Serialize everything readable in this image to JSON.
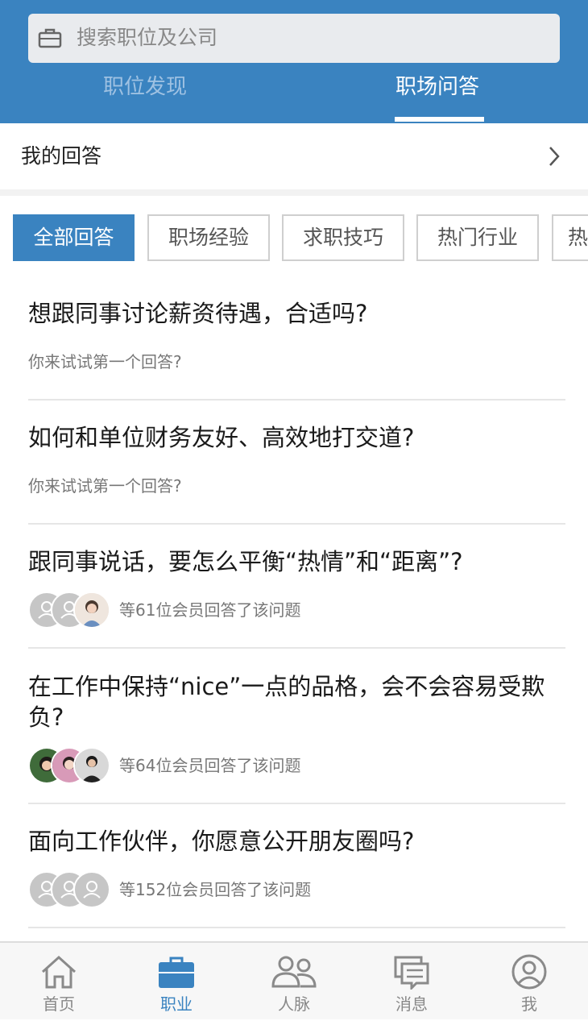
{
  "header": {
    "search_placeholder": "搜索职位及公司",
    "tabs": [
      {
        "label": "职位发现",
        "active": false
      },
      {
        "label": "职场问答",
        "active": true
      }
    ]
  },
  "my_answers": {
    "label": "我的回答"
  },
  "categories": [
    {
      "label": "全部回答",
      "active": true
    },
    {
      "label": "职场经验",
      "active": false
    },
    {
      "label": "求职技巧",
      "active": false
    },
    {
      "label": "热门行业",
      "active": false
    },
    {
      "label": "热",
      "active": false
    }
  ],
  "questions": [
    {
      "title": "想跟同事讨论薪资待遇，合适吗?",
      "sub": "你来试试第一个回答?"
    },
    {
      "title": "如何和单位财务友好、高效地打交道?",
      "sub": "你来试试第一个回答?"
    },
    {
      "title": "跟同事说话，要怎么平衡“热情”和“距离”?",
      "answers": "等61位会员回答了该问题"
    },
    {
      "title": "在工作中保持“nice”一点的品格，会不会容易受欺负?",
      "answers": "等64位会员回答了该问题"
    },
    {
      "title": "面向工作伙伴，你愿意公开朋友圈吗?",
      "answers": "等152位会员回答了该问题"
    }
  ],
  "bottom_nav": [
    {
      "label": "首页",
      "icon": "home-icon",
      "active": false
    },
    {
      "label": "职业",
      "icon": "briefcase-icon",
      "active": true
    },
    {
      "label": "人脉",
      "icon": "people-icon",
      "active": false
    },
    {
      "label": "消息",
      "icon": "message-icon",
      "active": false
    },
    {
      "label": "我",
      "icon": "user-icon",
      "active": false
    }
  ],
  "colors": {
    "brand": "#3a83c0",
    "tab_inactive": "#9ec1e2"
  }
}
